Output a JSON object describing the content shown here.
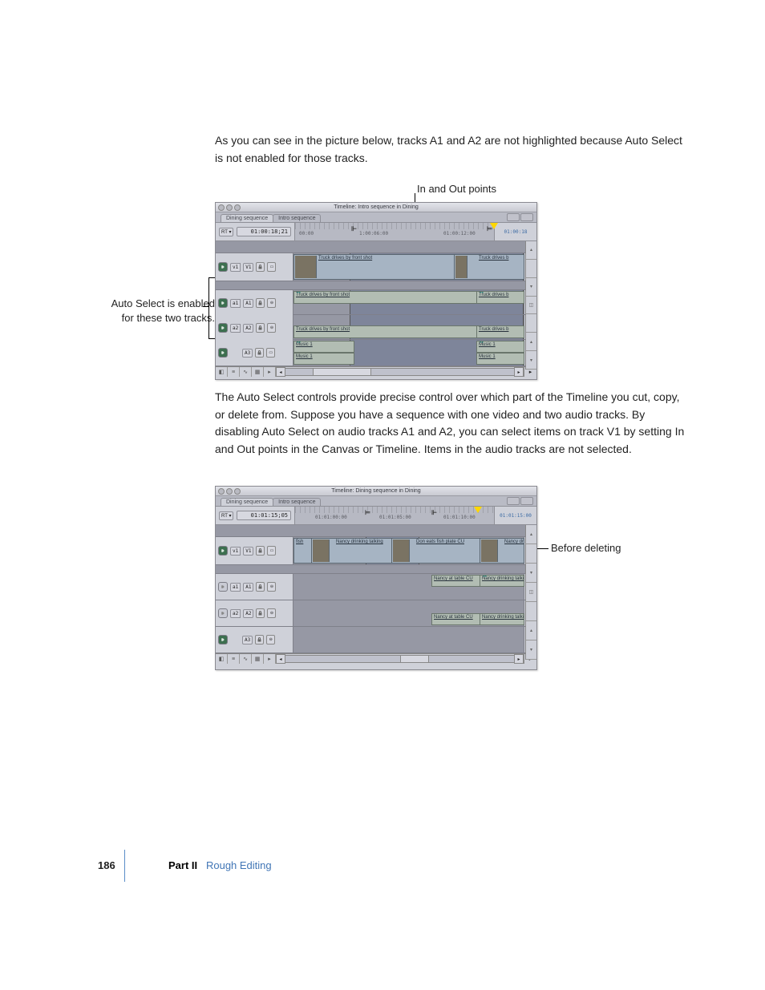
{
  "paragraphs": {
    "p1": "As you can see in the picture below, tracks A1 and A2 are not highlighted because Auto Select is not enabled for those tracks.",
    "p2": "The Auto Select controls provide precise control over which part of the Timeline you cut, copy, or delete from. Suppose you have a sequence with one video and two audio tracks. By disabling Auto Select on audio tracks A1 and A2, you can select items on track V1 by setting In and Out points in the Canvas or Timeline. Items in the audio tracks are not selected."
  },
  "callouts": {
    "top": "In and Out points",
    "left": "Auto Select is enabled for these two tracks.",
    "right": "Before deleting"
  },
  "shot1": {
    "title": "Timeline: Intro sequence in Dining",
    "tab_active": "Dining sequence",
    "tab_inactive": "Intro sequence",
    "rt": "RT ▾",
    "timecode": "01:00:18;21",
    "ruler": {
      "t1": "00:00",
      "t2": "1:00:06:00",
      "t3": "01:00:12:00",
      "end": "01:00:18"
    },
    "tracks": {
      "v1": {
        "src": "v1",
        "dst": "V1",
        "clip": "Truck drives by front shot",
        "clip2": "Truck drives b"
      },
      "a1": {
        "src": "a1",
        "dst": "A1",
        "clip": "Truck drives by front shot",
        "clip2": "Truck drives b"
      },
      "a2": {
        "src": "a2",
        "dst": "A2",
        "clip": "Truck drives by front shot",
        "clip2": "Truck drives b"
      },
      "a3": {
        "dst": "A3",
        "clip": "Music 1",
        "clip2": "Music 1",
        "clip3": "Music 1",
        "clip4": "Music 1"
      }
    }
  },
  "shot2": {
    "title": "Timeline: Dining sequence in Dining",
    "tab_active": "Dining sequence",
    "tab_inactive": "Intro sequence",
    "rt": "RT ▾",
    "timecode": "01:01:15;05",
    "ruler": {
      "t1": "01:01:00:00",
      "t2": "01:01:05:00",
      "t3": "01:01:10:00",
      "end": "01:01:15:00"
    },
    "tracks": {
      "v1": {
        "src": "v1",
        "dst": "V1",
        "c1": "fish",
        "c2": "Nancy drinking talking",
        "c3": "Don eats fish plate CU",
        "c4": "Nancy dri"
      },
      "a1": {
        "src": "a1",
        "dst": "A1",
        "c1": "Nancy at table CU",
        "c2": "Nancy drinking talking"
      },
      "a2": {
        "src": "a2",
        "dst": "A2",
        "c1": "Nancy at table CU",
        "c2": "Nancy drinking talking"
      },
      "a3": {
        "dst": "A3"
      }
    }
  },
  "footer": {
    "page": "186",
    "part": "Part II",
    "section": "Rough Editing"
  }
}
